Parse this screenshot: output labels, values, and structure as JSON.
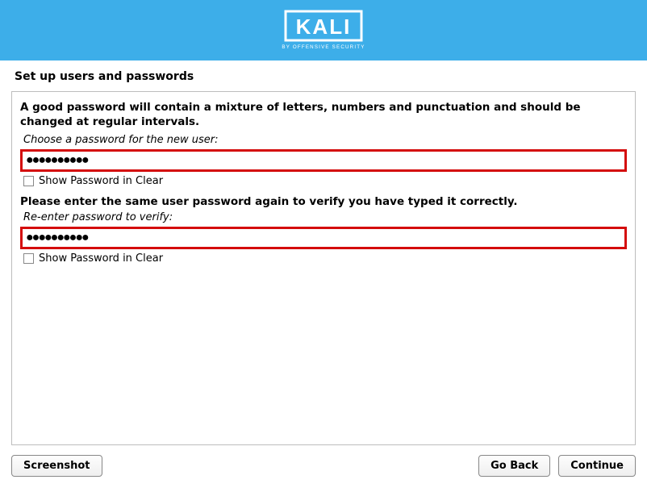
{
  "brand": {
    "name": "KALI",
    "tagline": "BY OFFENSIVE SECURITY"
  },
  "page_title": "Set up users and passwords",
  "intro": "A good password will contain a mixture of letters, numbers and punctuation and should be changed at regular intervals.",
  "password1": {
    "prompt": "Choose a password for the new user:",
    "value": "●●●●●●●●●●",
    "show_label": "Show Password in Clear"
  },
  "verify_heading": "Please enter the same user password again to verify you have typed it correctly.",
  "password2": {
    "prompt": "Re-enter password to verify:",
    "value": "●●●●●●●●●●",
    "show_label": "Show Password in Clear"
  },
  "buttons": {
    "screenshot": "Screenshot",
    "go_back": "Go Back",
    "continue": "Continue"
  }
}
